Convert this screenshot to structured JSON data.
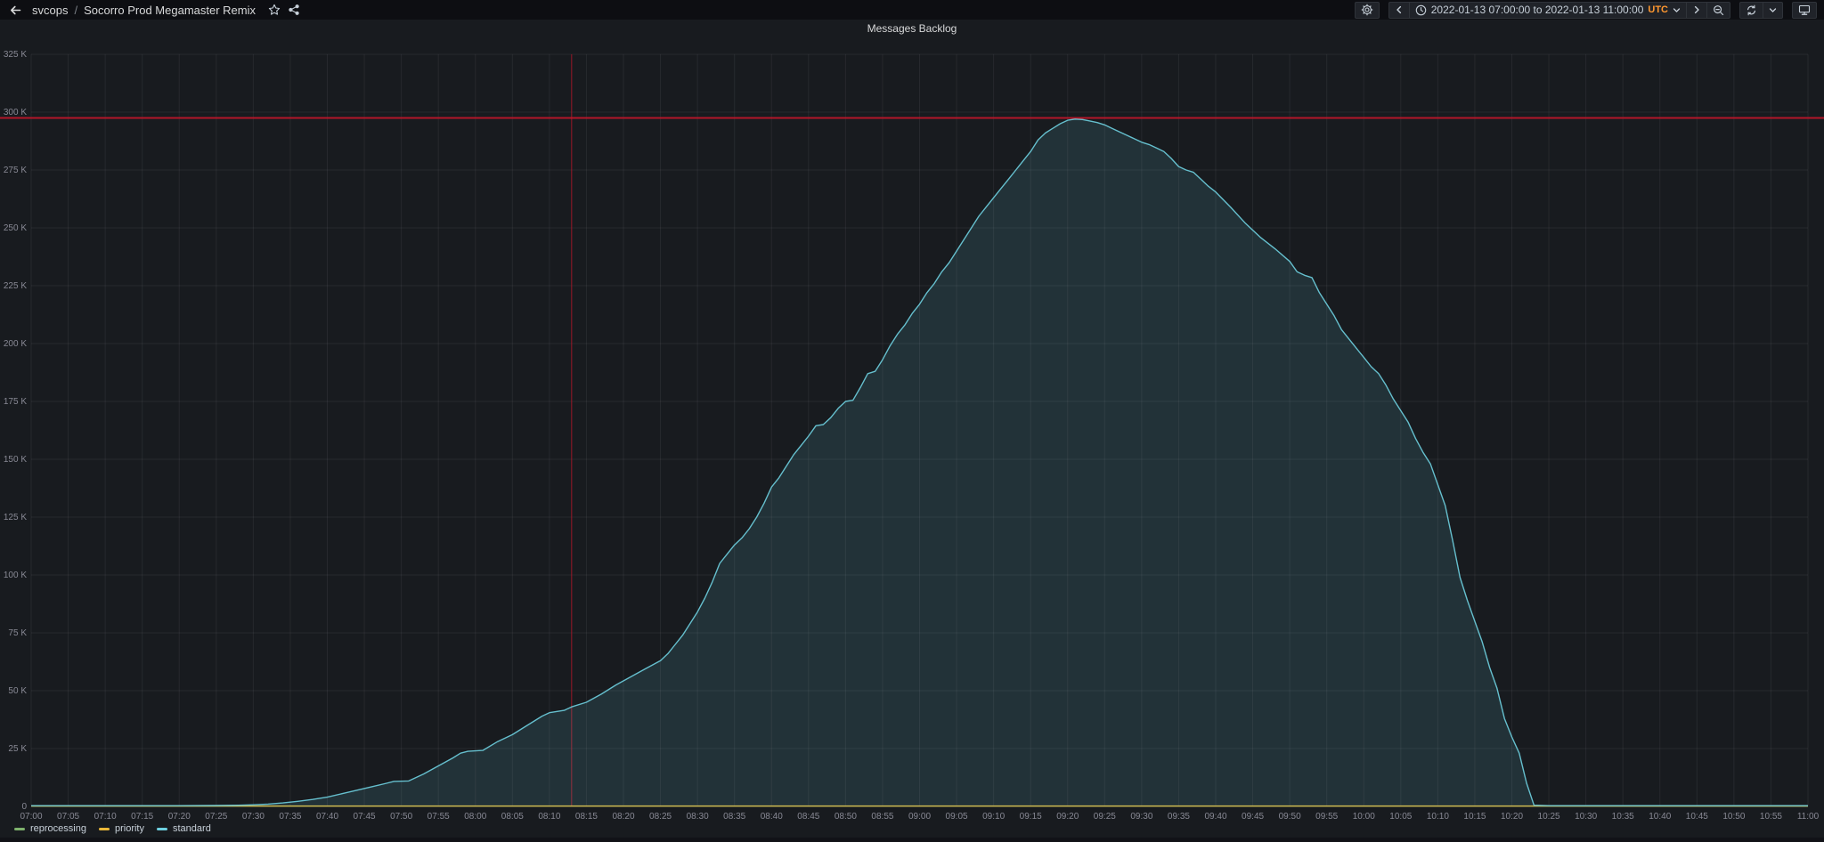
{
  "topbar": {
    "back_icon": "arrow-left",
    "breadcrumb": {
      "root": "svcops",
      "separator": "/",
      "page": "Socorro Prod Megamaster Remix"
    },
    "star_icon": "star",
    "share_icon": "share-alt",
    "settings_icon": "gear",
    "time_range": {
      "clock_icon": "clock",
      "label": "2022-01-13 07:00:00 to 2022-01-13 11:00:00",
      "timezone": "UTC",
      "prev_icon": "chevron-left",
      "next_icon": "chevron-right",
      "zoom_out_icon": "magnifier-minus",
      "dropdown_icon": "chevron-down"
    },
    "refresh_icon": "refresh",
    "refresh_dropdown_icon": "chevron-down",
    "kiosk_icon": "monitor"
  },
  "colors": {
    "page_background": "#111217",
    "panel_background": "#181b1f",
    "topbar_background": "#0d0e12",
    "threshold_red": "#C4162A",
    "timezone_orange": "#FF9830",
    "series_green": "#7EB26D",
    "series_yellow": "#EAB839",
    "series_blue": "#6ED0E0"
  },
  "chart_data": {
    "type": "area",
    "title": "Messages Backlog",
    "x_start": "07:00",
    "x_end": "11:00",
    "x_tick_interval_min": 5,
    "ylim": [
      0,
      325000
    ],
    "y_tick_interval": 25000,
    "y_tick_suffix": " K",
    "grid": true,
    "legend_position": "bottom-left",
    "threshold": {
      "value": 297500,
      "color": "#C4162A"
    },
    "annotation": {
      "time": "08:13",
      "color": "#C4162A"
    },
    "value_note": "points_k are [minutes after 07:00, value in thousands of messages]",
    "series": [
      {
        "name": "reprocessing",
        "color": "#7EB26D",
        "points_k": [
          [
            0,
            0.1
          ],
          [
            240,
            0.1
          ]
        ]
      },
      {
        "name": "priority",
        "color": "#EAB839",
        "points_k": [
          [
            0,
            0.15
          ],
          [
            240,
            0.15
          ]
        ]
      },
      {
        "name": "standard",
        "color": "#6ED0E0",
        "fill_opacity": 0.13,
        "points_k": [
          [
            0,
            0.3
          ],
          [
            5,
            0.3
          ],
          [
            10,
            0.3
          ],
          [
            15,
            0.3
          ],
          [
            20,
            0.3
          ],
          [
            25,
            0.4
          ],
          [
            28,
            0.5
          ],
          [
            30,
            0.7
          ],
          [
            32,
            1
          ],
          [
            34,
            1.5
          ],
          [
            36,
            2.2
          ],
          [
            38,
            3
          ],
          [
            40,
            4
          ],
          [
            42,
            5.5
          ],
          [
            44,
            7
          ],
          [
            46,
            8.5
          ],
          [
            48,
            10
          ],
          [
            49,
            10.8
          ],
          [
            51,
            11
          ],
          [
            53,
            14
          ],
          [
            55,
            17.5
          ],
          [
            57,
            21
          ],
          [
            58,
            23
          ],
          [
            59,
            23.8
          ],
          [
            61,
            24.2
          ],
          [
            63,
            28
          ],
          [
            65,
            31
          ],
          [
            67,
            35
          ],
          [
            69,
            39
          ],
          [
            70,
            40.5
          ],
          [
            72,
            41.5
          ],
          [
            73,
            43
          ],
          [
            75,
            45
          ],
          [
            77,
            48.5
          ],
          [
            79,
            52.5
          ],
          [
            81,
            56
          ],
          [
            83,
            59.5
          ],
          [
            85,
            63
          ],
          [
            86,
            66
          ],
          [
            87,
            70
          ],
          [
            88,
            74
          ],
          [
            89,
            79
          ],
          [
            90,
            84
          ],
          [
            91,
            90
          ],
          [
            92,
            97
          ],
          [
            93,
            105
          ],
          [
            94,
            109
          ],
          [
            95,
            113
          ],
          [
            96,
            116
          ],
          [
            97,
            120
          ],
          [
            98,
            125
          ],
          [
            99,
            131
          ],
          [
            100,
            138
          ],
          [
            101,
            142
          ],
          [
            102,
            147
          ],
          [
            103,
            152
          ],
          [
            104,
            156
          ],
          [
            105,
            160
          ],
          [
            106,
            164.5
          ],
          [
            107,
            165
          ],
          [
            108,
            168
          ],
          [
            109,
            172
          ],
          [
            110,
            175
          ],
          [
            111,
            175.5
          ],
          [
            112,
            181
          ],
          [
            113,
            187
          ],
          [
            114,
            188
          ],
          [
            115,
            193
          ],
          [
            116,
            199
          ],
          [
            117,
            204
          ],
          [
            118,
            208
          ],
          [
            119,
            213
          ],
          [
            120,
            217
          ],
          [
            121,
            222
          ],
          [
            122,
            226
          ],
          [
            123,
            231
          ],
          [
            124,
            235
          ],
          [
            125,
            240
          ],
          [
            126,
            245
          ],
          [
            127,
            250
          ],
          [
            128,
            255
          ],
          [
            129,
            259
          ],
          [
            130,
            263
          ],
          [
            131,
            267
          ],
          [
            132,
            271
          ],
          [
            133,
            275
          ],
          [
            134,
            279
          ],
          [
            135,
            283
          ],
          [
            136,
            288
          ],
          [
            137,
            291
          ],
          [
            138,
            293
          ],
          [
            139,
            295
          ],
          [
            140,
            296.5
          ],
          [
            141,
            297
          ],
          [
            142,
            296.8
          ],
          [
            143,
            296.2
          ],
          [
            144,
            295.5
          ],
          [
            145,
            294.5
          ],
          [
            146,
            293
          ],
          [
            147,
            291.5
          ],
          [
            148,
            290
          ],
          [
            149,
            288.5
          ],
          [
            150,
            287
          ],
          [
            151,
            286
          ],
          [
            152,
            284.5
          ],
          [
            153,
            283
          ],
          [
            154,
            280
          ],
          [
            155,
            276.5
          ],
          [
            156,
            275
          ],
          [
            157,
            274
          ],
          [
            158,
            271
          ],
          [
            159,
            268
          ],
          [
            160,
            265.5
          ],
          [
            162,
            259
          ],
          [
            164,
            252
          ],
          [
            166,
            246
          ],
          [
            168,
            241
          ],
          [
            170,
            235.5
          ],
          [
            171,
            231
          ],
          [
            172,
            229.5
          ],
          [
            173,
            228.5
          ],
          [
            174,
            222
          ],
          [
            175,
            217
          ],
          [
            176,
            212
          ],
          [
            177,
            206
          ],
          [
            178,
            202
          ],
          [
            179,
            198
          ],
          [
            180,
            194
          ],
          [
            181,
            190
          ],
          [
            182,
            187
          ],
          [
            183,
            182
          ],
          [
            184,
            176
          ],
          [
            185,
            171
          ],
          [
            186,
            166
          ],
          [
            187,
            159
          ],
          [
            188,
            153
          ],
          [
            189,
            148
          ],
          [
            190,
            139
          ],
          [
            191,
            130
          ],
          [
            192,
            115
          ],
          [
            193,
            99
          ],
          [
            194,
            89
          ],
          [
            195,
            80
          ],
          [
            196,
            71
          ],
          [
            197,
            60
          ],
          [
            198,
            51
          ],
          [
            199,
            38
          ],
          [
            200,
            30
          ],
          [
            201,
            23
          ],
          [
            202,
            10
          ],
          [
            203,
            0.5
          ],
          [
            205,
            0.3
          ],
          [
            210,
            0.3
          ],
          [
            215,
            0.3
          ],
          [
            220,
            0.3
          ],
          [
            225,
            0.3
          ],
          [
            230,
            0.3
          ],
          [
            235,
            0.3
          ],
          [
            240,
            0.3
          ]
        ]
      }
    ]
  }
}
